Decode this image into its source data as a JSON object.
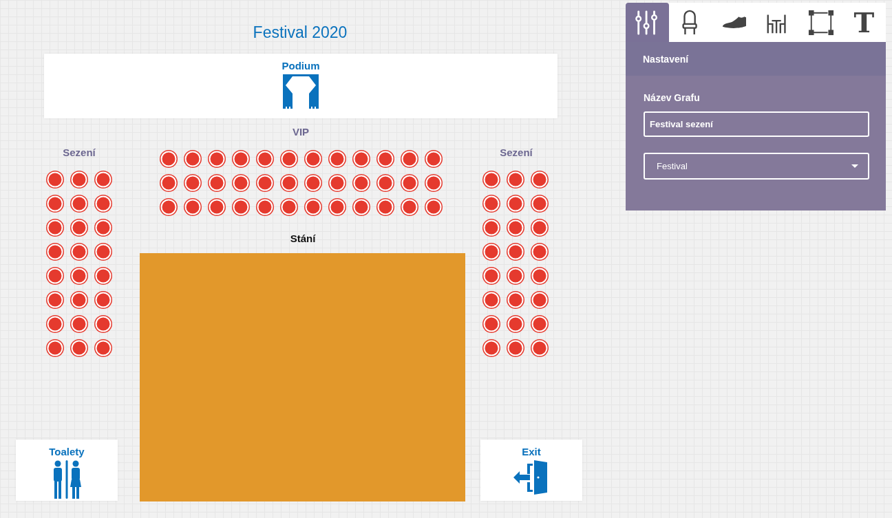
{
  "plan": {
    "title": "Festival 2020",
    "boxes": [
      {
        "kind": "stage",
        "label": "Podium"
      },
      {
        "kind": "toilets",
        "label": "Toalety"
      },
      {
        "kind": "exit",
        "label": "Exit"
      }
    ],
    "sections": [
      {
        "kind": "vip",
        "label": "VIP"
      },
      {
        "kind": "left",
        "label": "Sezení"
      },
      {
        "kind": "right",
        "label": "Sezení"
      },
      {
        "kind": "standing",
        "label": "Stání"
      }
    ]
  },
  "panel": {
    "tabs": [
      {
        "kind": "sliders",
        "selected": true
      },
      {
        "kind": "chair",
        "selected": false
      },
      {
        "kind": "shoe",
        "selected": false
      },
      {
        "kind": "table",
        "selected": false
      },
      {
        "kind": "frame",
        "selected": false
      },
      {
        "kind": "glyph",
        "label": "T",
        "selected": false
      }
    ],
    "header": "Nastavení",
    "field_label": "Název Grafu",
    "name_field": {
      "value": "Festival sezení"
    },
    "type_select": {
      "value": "Festival"
    }
  }
}
